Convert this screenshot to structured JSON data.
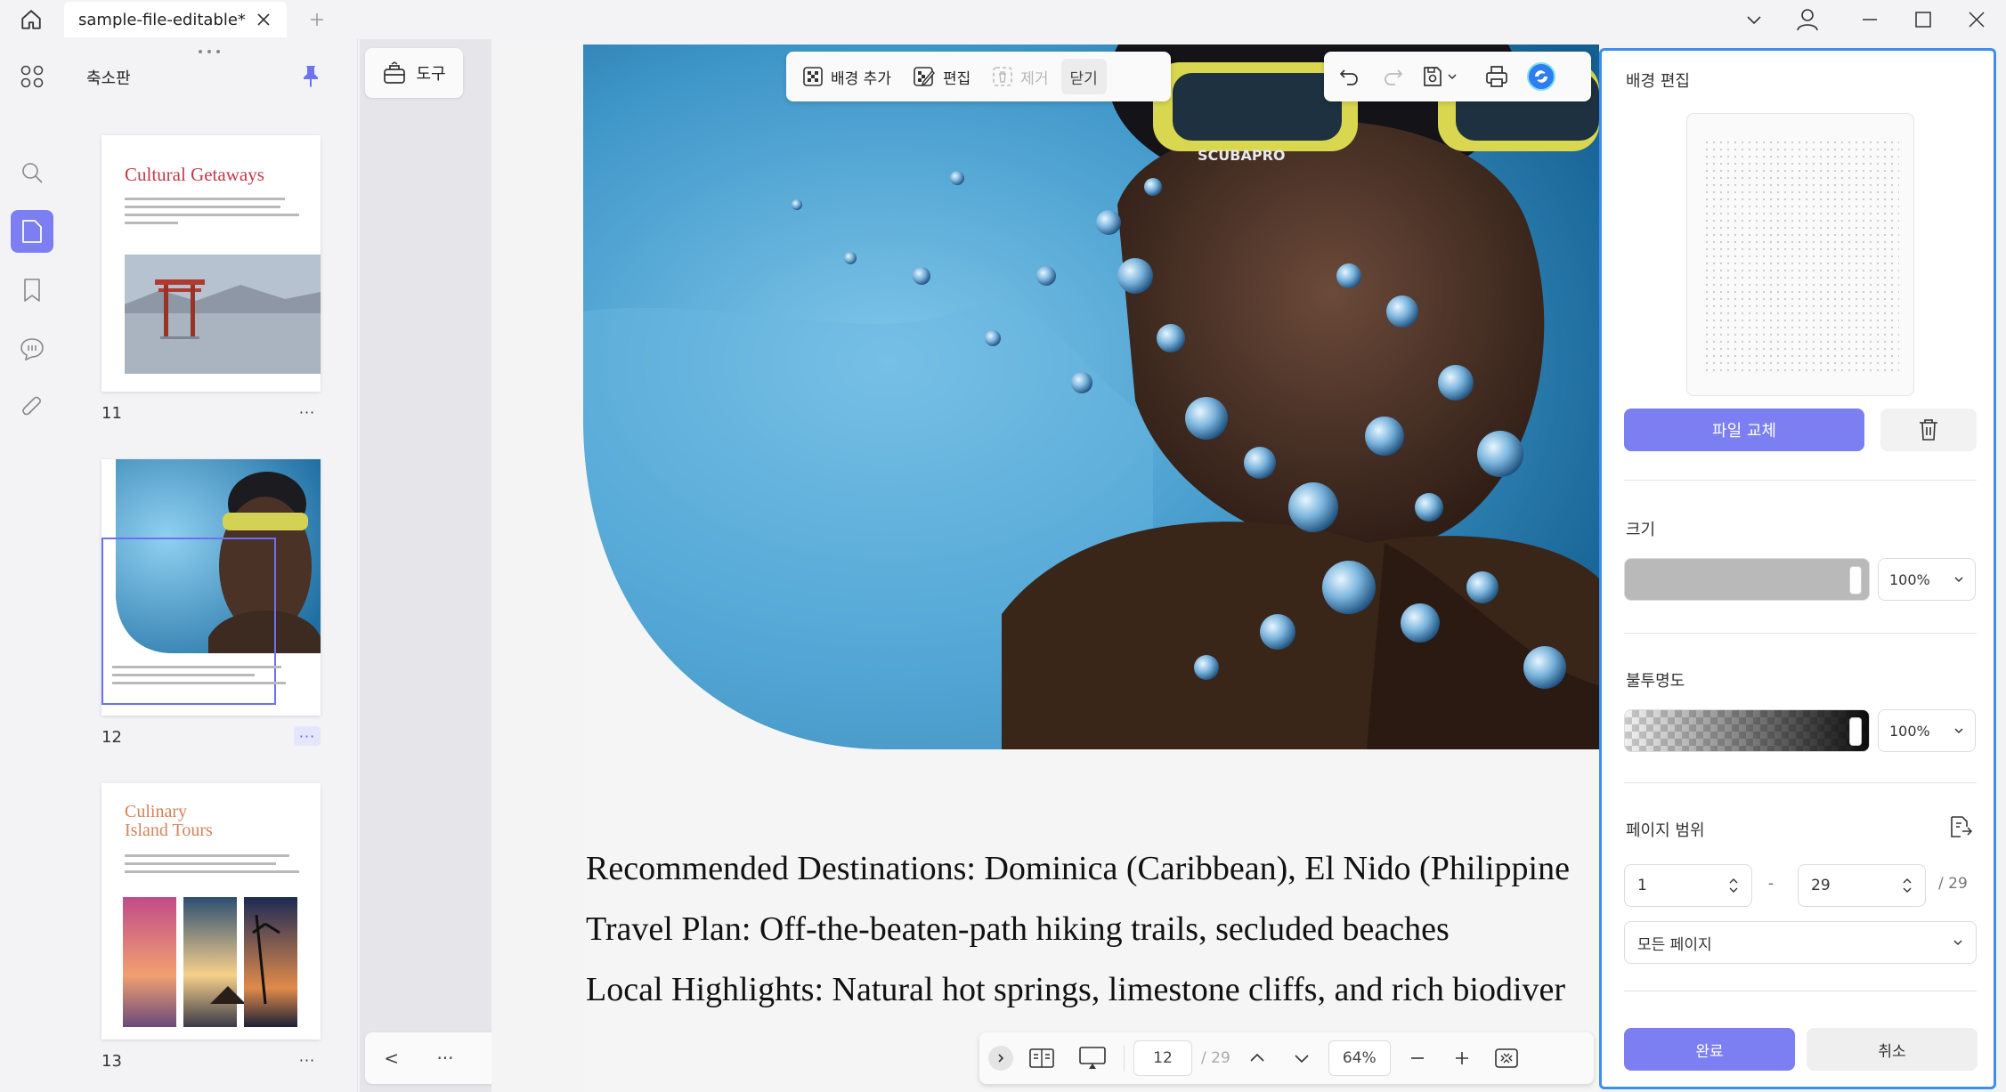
{
  "tab": {
    "title": "sample-file-editable*"
  },
  "thumbnails": {
    "title": "축소판",
    "pages": [
      {
        "number": "11",
        "heading": "Cultural Getaways"
      },
      {
        "number": "12",
        "heading": ""
      },
      {
        "number": "13",
        "heading": "Culinary Island Tours",
        "heading_line1": "Culinary",
        "heading_line2": "Island Tours"
      }
    ],
    "more_label": "···"
  },
  "tools": {
    "label": "도구",
    "prev": "<",
    "more": "···",
    "next": ">"
  },
  "edit_toolbar": {
    "add_background": "배경 추가",
    "edit": "편집",
    "remove": "제거",
    "close": "닫기"
  },
  "document": {
    "lines": [
      "Recommended Destinations: Dominica (Caribbean), El Nido (Philippine",
      "Travel Plan: Off-the-beaten-path hiking trails, secluded beaches",
      "Local Highlights: Natural hot springs, limestone cliffs, and rich biodiver"
    ],
    "mask_text": "SCUBAPRO"
  },
  "bottom_bar": {
    "current_page": "12",
    "total_pages": "/ 29",
    "zoom": "64%"
  },
  "right_panel": {
    "title": "배경 편집",
    "replace_file": "파일 교체",
    "size_label": "크기",
    "size_value": "100%",
    "opacity_label": "불투명도",
    "opacity_value": "100%",
    "range_label": "페이지 범위",
    "range_from": "1",
    "range_sep": "-",
    "range_to": "29",
    "range_total": "/ 29",
    "pages_option": "모든 페이지",
    "done": "완료",
    "cancel": "취소"
  },
  "colors": {
    "accent": "#7b7ff2",
    "panel_border": "#3d8ef0"
  }
}
